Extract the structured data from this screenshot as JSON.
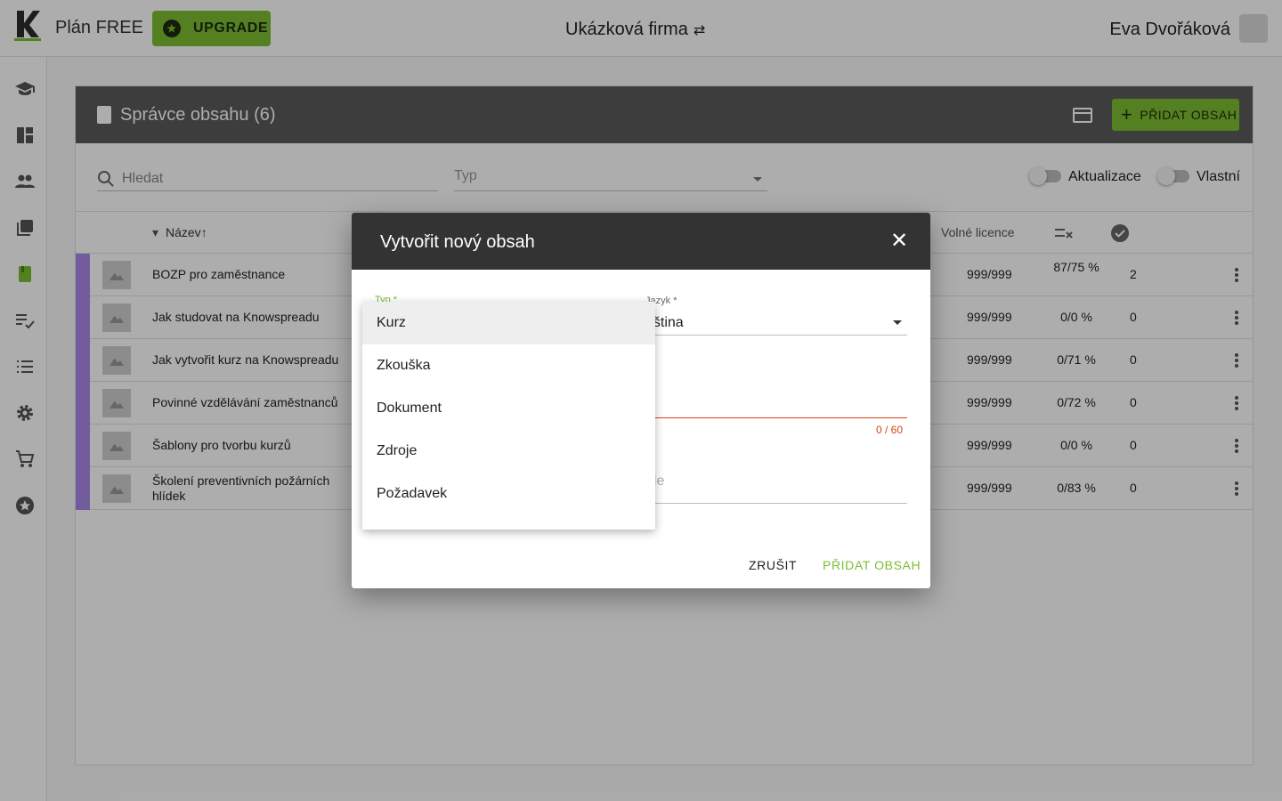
{
  "topbar": {
    "plan": "Plán FREE",
    "upgrade_label": "UPGRADE",
    "company": "Ukázková firma",
    "user_name": "Eva Dvořáková"
  },
  "sidebar": {
    "icons": [
      "graduation-cap-icon",
      "dashboard-icon",
      "people-icon",
      "library-icon",
      "book-icon",
      "checklist-icon",
      "list-icon",
      "gear-icon",
      "cart-icon",
      "star-icon"
    ]
  },
  "content": {
    "title": "Správce obsahu (6)",
    "add_label": "PŘIDAT OBSAH",
    "search_placeholder": "Hledat",
    "type_placeholder": "Typ",
    "toggle_updates": "Aktualizace",
    "toggle_own": "Vlastní",
    "columns": {
      "name": "Název",
      "licenses": "Volné licence"
    },
    "rows": [
      {
        "name": "BOZP pro zaměstnance",
        "licenses": "999/999",
        "percent": "87/75 %",
        "count": "2"
      },
      {
        "name": "Jak studovat na Knowspreadu",
        "licenses": "999/999",
        "percent": "0/0 %",
        "count": "0"
      },
      {
        "name": "Jak vytvořit kurz na Knowspreadu",
        "licenses": "999/999",
        "percent": "0/71 %",
        "count": "0"
      },
      {
        "name": "Povinné vzdělávání zaměstnanců",
        "licenses": "999/999",
        "percent": "0/72 %",
        "count": "0"
      },
      {
        "name": "Šablony pro tvorbu kurzů",
        "licenses": "999/999",
        "percent": "0/0 %",
        "count": "0"
      },
      {
        "name": "Školení preventivních požárních hlídek",
        "licenses": "999/999",
        "percent": "0/83 %",
        "count": "0"
      }
    ]
  },
  "dialog": {
    "title": "Vytvořit nový obsah",
    "type_label": "Typ *",
    "language_label": "Jazyk *",
    "language_value": "eština",
    "name_counter": "0 / 60",
    "description_partial": "ele",
    "cancel_label": "ZRUŠIT",
    "submit_label": "PŘIDAT OBSAH",
    "type_options": [
      "Kurz",
      "Zkouška",
      "Dokument",
      "Zdroje",
      "Požadavek"
    ],
    "selected_option": "Kurz"
  },
  "colors": {
    "accent": "#7cbd33",
    "error": "#d84315",
    "stripe": "#a988e8"
  }
}
